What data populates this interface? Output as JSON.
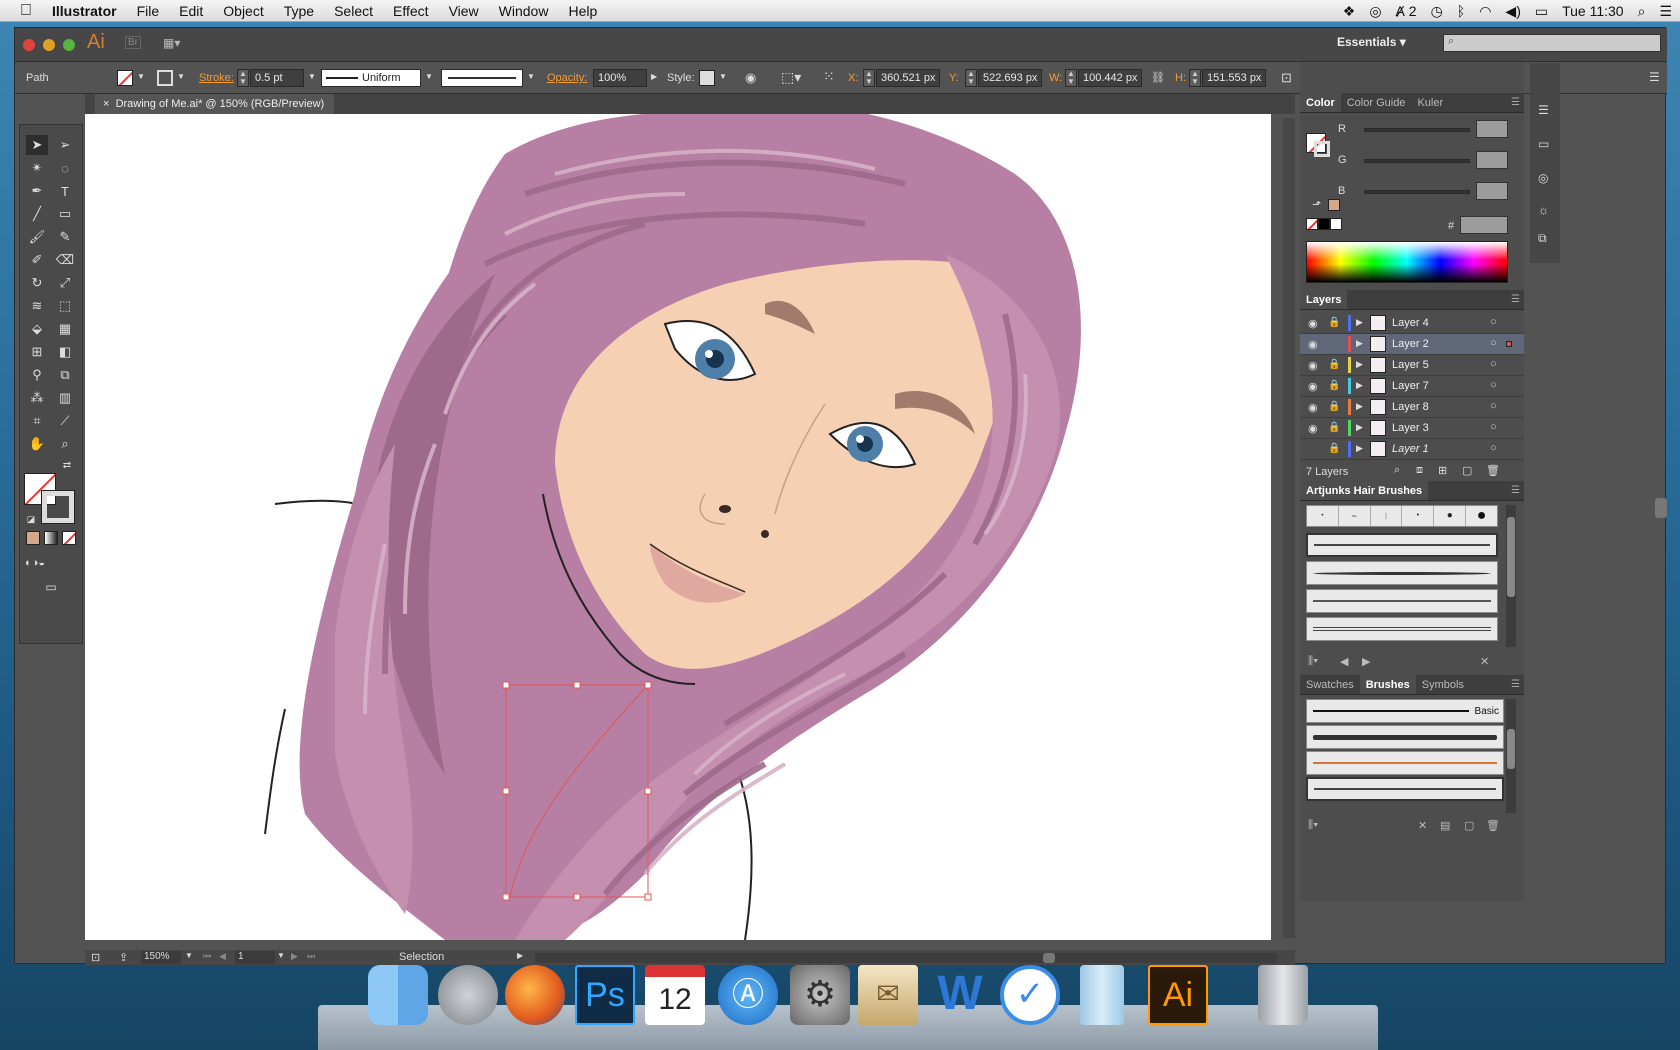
{
  "menubar": {
    "app": "Illustrator",
    "items": [
      "File",
      "Edit",
      "Object",
      "Type",
      "Select",
      "Effect",
      "View",
      "Window",
      "Help"
    ],
    "clock": "Tue 11:30",
    "badge": "2"
  },
  "apphdr": {
    "logo": "Ai",
    "bridge": "Br",
    "workspace": "Essentials",
    "workspace_caret": "▾"
  },
  "control": {
    "object_type": "Path",
    "stroke_label": "Stroke:",
    "stroke_value": "0.5 pt",
    "profile": "Uniform",
    "opacity_label": "Opacity:",
    "opacity_value": "100%",
    "style_label": "Style:",
    "x_label": "X:",
    "x_value": "360.521 px",
    "y_label": "Y:",
    "y_value": "522.693 px",
    "w_label": "W:",
    "w_value": "100.442 px",
    "h_label": "H:",
    "h_value": "151.553 px"
  },
  "document": {
    "tab_close": "×",
    "tab_title": "Drawing of Me.ai* @ 150% (RGB/Preview)",
    "zoom": "150%",
    "artboard": "1",
    "status": "Selection"
  },
  "color_panel": {
    "tabs": [
      "Color",
      "Color Guide",
      "Kuler"
    ],
    "channels": [
      "R",
      "G",
      "B"
    ],
    "hex_label": "#"
  },
  "layers_panel": {
    "title": "Layers",
    "count": "7 Layers",
    "layers": [
      {
        "name": "Layer 4",
        "color": "#4f6ef7",
        "locked": true,
        "eye": true
      },
      {
        "name": "Layer 2",
        "color": "#e25050",
        "locked": false,
        "eye": true,
        "selected": true
      },
      {
        "name": "Layer 5",
        "color": "#e6d345",
        "locked": true,
        "eye": true
      },
      {
        "name": "Layer 7",
        "color": "#45c8e6",
        "locked": true,
        "eye": true
      },
      {
        "name": "Layer 8",
        "color": "#e67a45",
        "locked": true,
        "eye": true
      },
      {
        "name": "Layer 3",
        "color": "#4fd760",
        "locked": true,
        "eye": true
      },
      {
        "name": "Layer 1",
        "color": "#4f6ef7",
        "locked": true,
        "eye": false
      }
    ]
  },
  "hair_brushes_panel": {
    "title": "Artjunks Hair Brushes"
  },
  "brushes_panel": {
    "tabs": [
      "Swatches",
      "Brushes",
      "Symbols"
    ],
    "basic_label": "Basic"
  },
  "colors": {
    "hair": "#c58fb0",
    "hair_dark": "#9e6a8c",
    "hair_light": "#d6b3c6",
    "skin": "#f6d0b3",
    "skin_shadow": "#c9a085",
    "eye": "#4e7fa8",
    "lips": "#e0a9a0",
    "selection": "#e35454",
    "ui_accent": "#f39c33"
  }
}
